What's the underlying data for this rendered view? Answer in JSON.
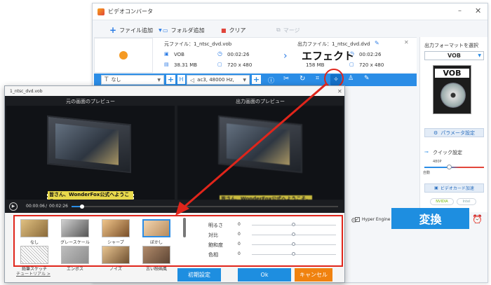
{
  "app": {
    "title": "ビデオコンバータ",
    "toolbar": {
      "add_file": "ファイル追加",
      "add_folder": "フォルダ追加",
      "clear": "クリア",
      "merge": "マージ"
    },
    "file": {
      "source_label": "元ファイル：1_ntsc_dvd.vob",
      "output_label": "出力ファイル：1_ntsc_dvd.dvd",
      "src_format": "VOB",
      "src_duration": "00:02:26",
      "src_size": "38.31 MB",
      "src_resolution": "720 x 480",
      "out_format": "VOB",
      "out_duration": "00:02:26",
      "out_size": "158 MB",
      "out_resolution": "720 x 480"
    },
    "subtitle_select": "なし",
    "audio_select": "ac3, 48000 Hz,",
    "effect_callout": "エフェクト",
    "right_panel": {
      "format_heading": "出力フォーマットを選択",
      "format_value": "VOB",
      "format_image_text": "VOB",
      "param_button": "パラメータ設定",
      "quick_heading": "クイック設定",
      "quick_value": "480P",
      "quick_auto": "自動",
      "gpu_button": "ビデオカード加速",
      "nvidia": "NVIDIA",
      "intel": "Intel"
    },
    "hyper_engine": "Hyper Engine",
    "convert_button": "変換"
  },
  "dialog": {
    "title": "1_ntsc_dvd.vob",
    "original_preview": "元の画面のプレビュー",
    "output_preview": "出力画面のプレビュー",
    "subtitle_text": "皆さん、WonderFox公式へようこそ。",
    "time_current": "00:00:06",
    "time_sep": "/",
    "time_total": "00:02:26",
    "progress": 0.04,
    "filters": [
      {
        "label": "なし"
      },
      {
        "label": "グレースケール"
      },
      {
        "label": "シャープ"
      },
      {
        "label": "ぼかし"
      },
      {
        "label": "鉛筆スケッチ"
      },
      {
        "label": "エンボス"
      },
      {
        "label": "ノイズ"
      },
      {
        "label": "古い映画風"
      }
    ],
    "adjust": [
      {
        "label": "明るさ",
        "value": "0",
        "level": 0.5
      },
      {
        "label": "対比",
        "value": "0",
        "level": 0.5
      },
      {
        "label": "飽和度",
        "value": "0",
        "level": 0.5
      },
      {
        "label": "色相",
        "value": "0",
        "level": 0.5
      }
    ],
    "tutorial_link": "チュートリアル >",
    "reset_button": "初期設定",
    "ok_button": "Ok",
    "cancel_button": "キャンセル"
  },
  "colors": {
    "accent": "#1e8ee0",
    "red": "#e0251b",
    "orange": "#f0820f"
  }
}
